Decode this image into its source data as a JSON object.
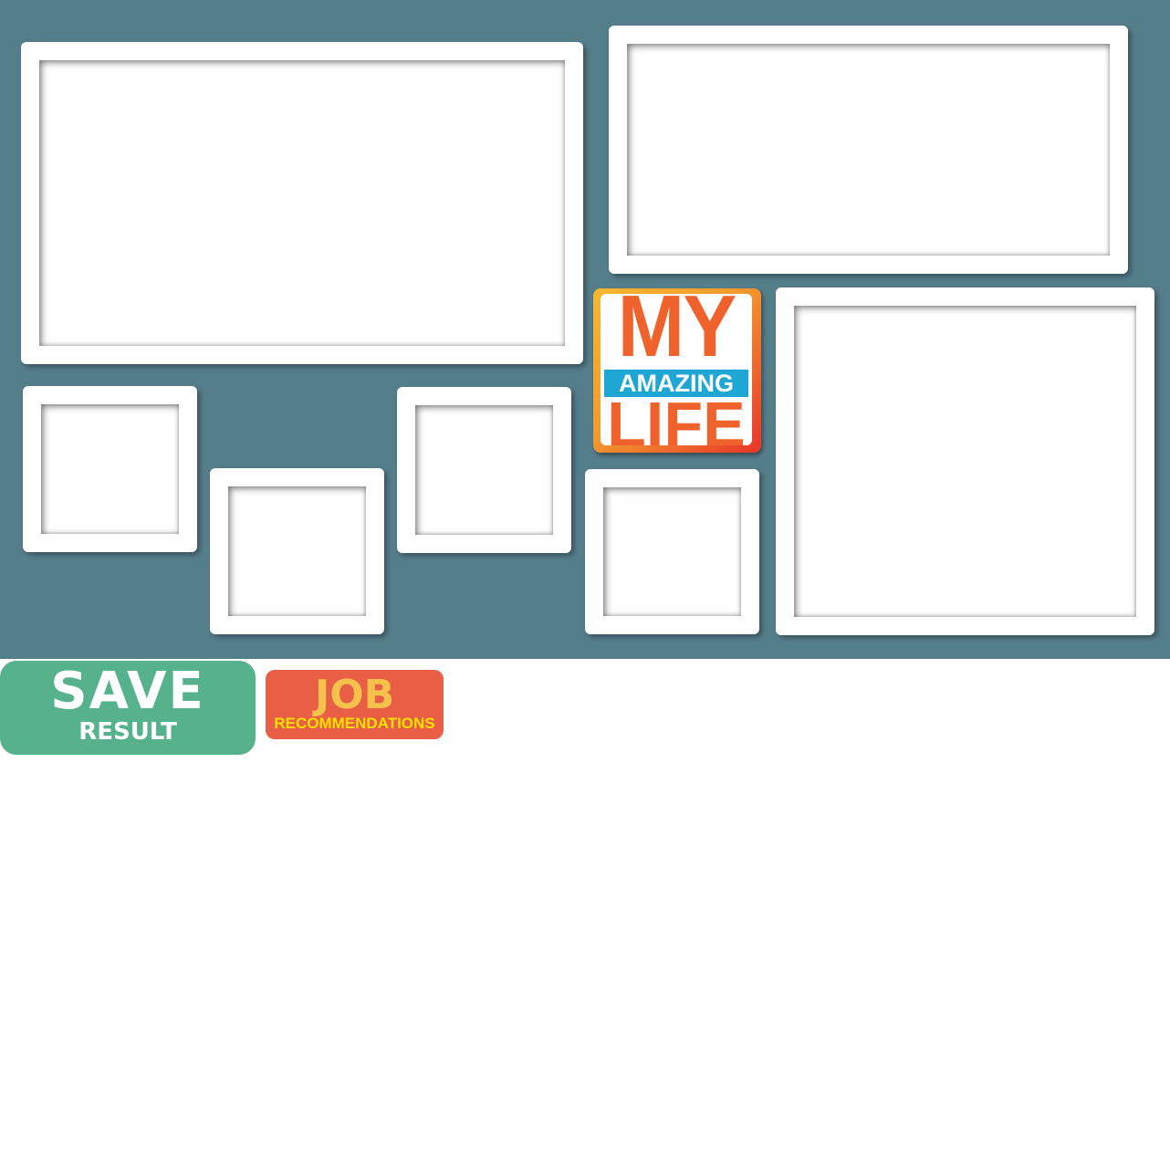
{
  "logo": {
    "line1": "MY",
    "line2": "AMAZING",
    "line3": "LIFE"
  },
  "buttons": {
    "save": {
      "main": "SAVE",
      "sub": "RESULT",
      "color": "#56b28d"
    },
    "job": {
      "main": "JOB",
      "sub": "RECOMMENDATIONS",
      "color": "#e95f45"
    }
  },
  "colors": {
    "board": "#557e8b",
    "frame": "#ffffff"
  },
  "frames_count": 8
}
